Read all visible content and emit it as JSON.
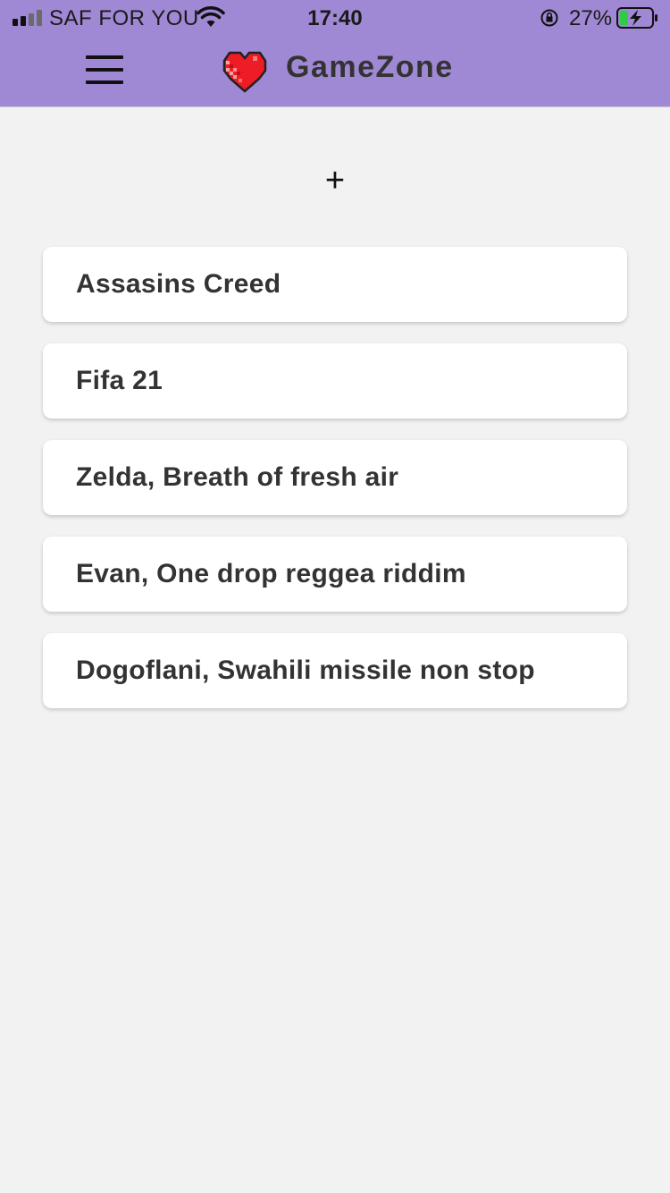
{
  "status_bar": {
    "carrier": "SAF FOR YOU",
    "time": "17:40",
    "battery_percent": "27%",
    "icons": [
      "signal-icon",
      "wifi-icon",
      "rotation-lock-icon",
      "battery-charging-icon"
    ]
  },
  "header": {
    "title": "GameZone",
    "menu_icon": "hamburger-menu-icon",
    "logo_icon": "pixel-heart-icon",
    "background_color": "#9f88d4"
  },
  "actions": {
    "add_label": "+"
  },
  "reviews": [
    {
      "title": "Assasins Creed"
    },
    {
      "title": "Fifa 21"
    },
    {
      "title": "Zelda, Breath of fresh air"
    },
    {
      "title": "Evan, One drop reggea riddim"
    },
    {
      "title": "Dogoflani, Swahili missile non stop"
    }
  ]
}
